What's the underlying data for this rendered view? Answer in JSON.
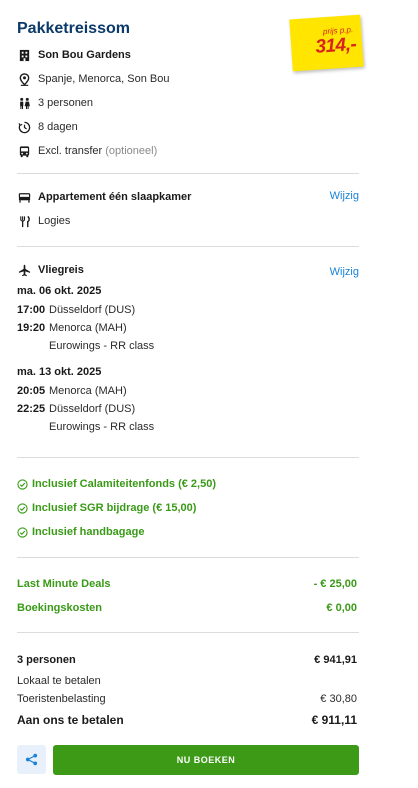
{
  "header": {
    "title": "Pakketreissom",
    "price_label": "prijs p.p.",
    "price_value": "314,-"
  },
  "summary": {
    "hotel": "Son Bou Gardens",
    "location": "Spanje, Menorca, Son Bou",
    "persons": "3 personen",
    "duration": "8 dagen",
    "transfer": "Excl. transfer",
    "transfer_note": "(optioneel)"
  },
  "accommodation": {
    "room": "Appartement één slaapkamer",
    "board": "Logies",
    "change_label": "Wijzig"
  },
  "flight": {
    "title": "Vliegreis",
    "change_label": "Wijzig",
    "outbound": {
      "date": "ma. 06 okt. 2025",
      "dep_time": "17:00",
      "dep_airport": "Düsseldorf (DUS)",
      "arr_time": "19:20",
      "arr_airport": "Menorca (MAH)",
      "carrier": "Eurowings - RR class"
    },
    "return": {
      "date": "ma. 13 okt. 2025",
      "dep_time": "20:05",
      "dep_airport": "Menorca (MAH)",
      "arr_time": "22:25",
      "arr_airport": "Düsseldorf (DUS)",
      "carrier": "Eurowings - RR class"
    }
  },
  "inclusions": [
    "Inclusief Calamiteitenfonds (€ 2,50)",
    "Inclusief SGR bijdrage (€ 15,00)",
    "Inclusief handbagage"
  ],
  "adjustments": {
    "deals_label": "Last Minute Deals",
    "deals_value": "- € 25,00",
    "fees_label": "Boekingskosten",
    "fees_value": "€ 0,00"
  },
  "totals": {
    "persons_label": "3 personen",
    "persons_value": "€ 941,91",
    "local_label": "Lokaal te betalen",
    "tax_label": "Toeristenbelasting",
    "tax_value": "€ 30,80",
    "pay_label": "Aan ons te betalen",
    "pay_value": "€ 911,11"
  },
  "actions": {
    "book_label": "NU BOEKEN"
  },
  "colors": {
    "title": "#0b3a6a",
    "accent_green": "#3d9a16",
    "link_blue": "#1a82d8",
    "badge_yellow": "#ffe500",
    "price_red": "#d9221e"
  }
}
